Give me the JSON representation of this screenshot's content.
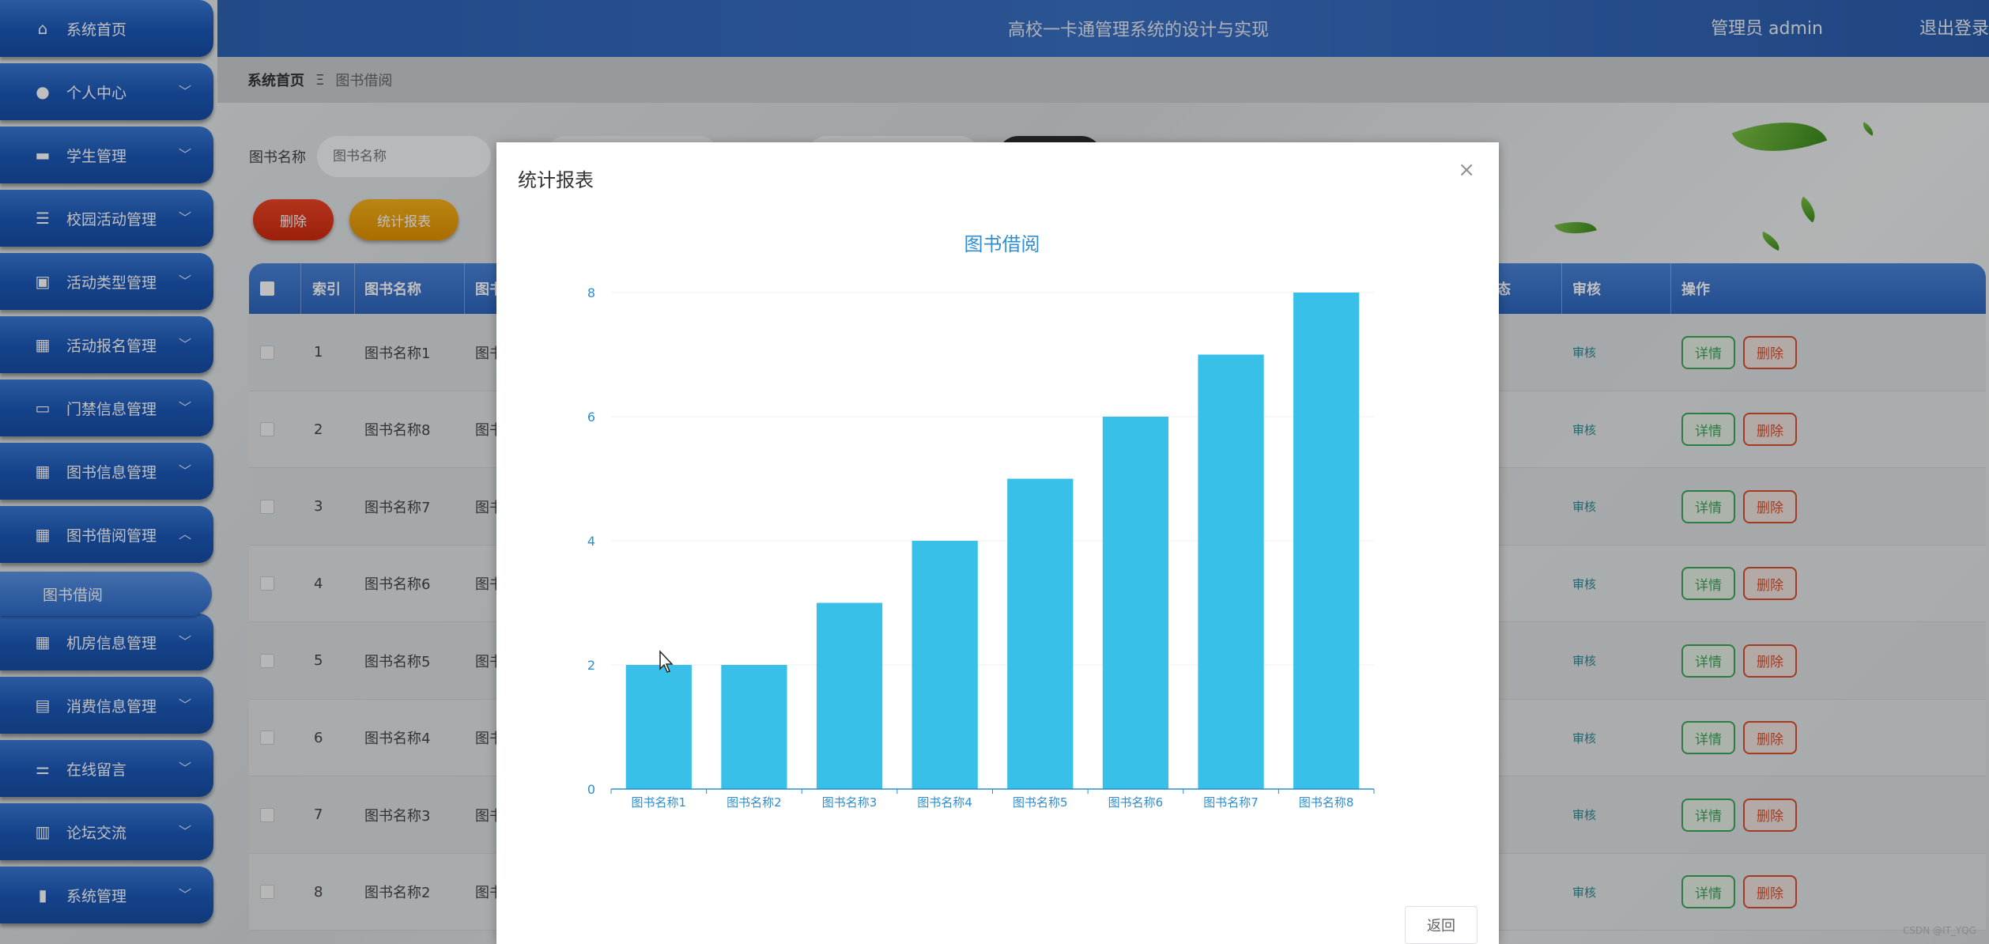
{
  "colors": {
    "sidebar": "#1b58b8",
    "header": "#2e63b5",
    "accent_bar": "#38c0e8",
    "axis_text": "#2f8ecf",
    "chart_title": "#2f8ecf",
    "delete_red": "#cf2a10",
    "stat_orange": "#e39100",
    "detail_green": "#3da65a"
  },
  "header": {
    "title": "高校一卡通管理系统的设计与实现",
    "user": "管理员 admin",
    "logout": "退出登录"
  },
  "sidebar": {
    "items": [
      {
        "label": "系统首页",
        "icon": "home-icon"
      },
      {
        "label": "个人中心",
        "icon": "user-icon"
      },
      {
        "label": "学生管理",
        "icon": "student-icon"
      },
      {
        "label": "校园活动管理",
        "icon": "list-icon"
      },
      {
        "label": "活动类型管理",
        "icon": "clipboard-icon"
      },
      {
        "label": "活动报名管理",
        "icon": "grid-icon"
      },
      {
        "label": "门禁信息管理",
        "icon": "monitor-icon"
      },
      {
        "label": "图书信息管理",
        "icon": "grid-icon"
      },
      {
        "label": "图书借阅管理",
        "icon": "grid-icon"
      },
      {
        "label": "机房信息管理",
        "icon": "grid-icon"
      },
      {
        "label": "消费信息管理",
        "icon": "ticket-icon"
      },
      {
        "label": "在线留言",
        "icon": "sliders-icon"
      },
      {
        "label": "论坛交流",
        "icon": "book-icon"
      },
      {
        "label": "系统管理",
        "icon": "bar-chart-icon"
      }
    ],
    "sub_item": "图书借阅"
  },
  "breadcrumb": {
    "home": "系统首页",
    "sep": "Ξ",
    "current": "图书借阅"
  },
  "search": {
    "label": "图书名称",
    "placeholder": "图书名称"
  },
  "actions": {
    "delete": "删除",
    "stats": "统计报表"
  },
  "table": {
    "headers": {
      "index": "索引",
      "book_name": "图书名称",
      "col3": "图书",
      "status": "状态",
      "audit": "审核",
      "ops": "操作"
    },
    "rows": [
      {
        "index": "1",
        "name": "图书名称1",
        "col3": "图书"
      },
      {
        "index": "2",
        "name": "图书名称8",
        "col3": "图书"
      },
      {
        "index": "3",
        "name": "图书名称7",
        "col3": "图书"
      },
      {
        "index": "4",
        "name": "图书名称6",
        "col3": "图书"
      },
      {
        "index": "5",
        "name": "图书名称5",
        "col3": "图书"
      },
      {
        "index": "6",
        "name": "图书名称4",
        "col3": "图书"
      },
      {
        "index": "7",
        "name": "图书名称3",
        "col3": "图书"
      },
      {
        "index": "8",
        "name": "图书名称2",
        "col3": "图书"
      }
    ],
    "audit_link": "审核",
    "detail_btn": "详情",
    "delete_btn": "删除"
  },
  "modal": {
    "title": "统计报表",
    "close": "×",
    "back": "返回"
  },
  "chart_data": {
    "type": "bar",
    "title": "图书借阅",
    "categories": [
      "图书名称1",
      "图书名称2",
      "图书名称3",
      "图书名称4",
      "图书名称5",
      "图书名称6",
      "图书名称7",
      "图书名称8"
    ],
    "values": [
      2,
      2,
      3,
      4,
      5,
      6,
      7,
      8
    ],
    "ylim": [
      0,
      8
    ],
    "yticks": [
      0,
      2,
      4,
      6,
      8
    ],
    "xlabel": "",
    "ylabel": "",
    "grid": true
  },
  "watermark": "CSDN @IT_YQG"
}
